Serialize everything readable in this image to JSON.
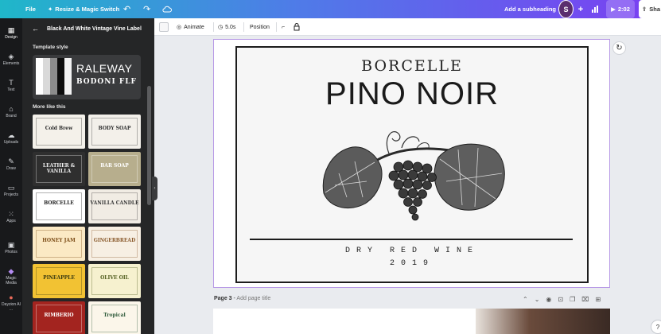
{
  "topbar": {
    "file": "File",
    "resize": "Resize & Magic Switch",
    "add_subheading": "Add a subheading",
    "avatar_initial": "S",
    "timer": "2:02",
    "share": "Sha"
  },
  "rail": {
    "items": [
      {
        "label": "Design",
        "icon": "design-icon"
      },
      {
        "label": "Elements",
        "icon": "elements-icon"
      },
      {
        "label": "Text",
        "icon": "text-icon"
      },
      {
        "label": "Brand",
        "icon": "brand-icon"
      },
      {
        "label": "Uploads",
        "icon": "uploads-icon"
      },
      {
        "label": "Draw",
        "icon": "draw-icon"
      },
      {
        "label": "Projects",
        "icon": "projects-icon"
      },
      {
        "label": "Apps",
        "icon": "apps-icon"
      },
      {
        "label": "Photos",
        "icon": "photos-icon"
      },
      {
        "label": "Magic Media",
        "icon": "magic-media-icon"
      },
      {
        "label": "Dayzion AI ...",
        "icon": "ai-app-icon"
      }
    ]
  },
  "panel": {
    "title": "Black And White Vintage Vine Label",
    "template_style": "Template style",
    "font_primary": "RALEWAY",
    "font_secondary": "BODONI FLF",
    "more_like_this": "More like this",
    "thumbnails": [
      {
        "title": "Cold Brew",
        "subtitle": "",
        "bg": "#f4f1ea",
        "fg": "#2b2b2b"
      },
      {
        "title": "BODY SOAP",
        "subtitle": "",
        "bg": "#f3f0ea",
        "fg": "#333333"
      },
      {
        "title": "LEATHER & VANILLA",
        "subtitle": "",
        "bg": "#2f2f2f",
        "fg": "#f2f2f2"
      },
      {
        "title": "BAR SOAP",
        "subtitle": "",
        "bg": "#b7ae8d",
        "fg": "#ffffff"
      },
      {
        "title": "BORCELLE",
        "subtitle": "",
        "bg": "#ffffff",
        "fg": "#1f1f1f"
      },
      {
        "title": "VANILLA CANDLE",
        "subtitle": "",
        "bg": "#f1ece4",
        "fg": "#3a3a3a"
      },
      {
        "title": "HONEY JAM",
        "subtitle": "",
        "bg": "#fbe9c4",
        "fg": "#7a4a14"
      },
      {
        "title": "GINGERBREAD",
        "subtitle": "",
        "bg": "#f7efe3",
        "fg": "#8a5a2c"
      },
      {
        "title": "PINEAPPLE",
        "subtitle": "",
        "bg": "#f2c233",
        "fg": "#3b3b10"
      },
      {
        "title": "OLIVE OIL",
        "subtitle": "",
        "bg": "#f6f1cf",
        "fg": "#4d5a1a"
      },
      {
        "title": "RIMBERIO",
        "subtitle": "",
        "bg": "#a3241f",
        "fg": "#ffffff"
      },
      {
        "title": "Tropical",
        "subtitle": "",
        "bg": "#fbf6ea",
        "fg": "#2e5a3a"
      }
    ]
  },
  "context_toolbar": {
    "animate": "Animate",
    "duration": "5.0s",
    "position": "Position"
  },
  "label": {
    "brand": "BORCELLE",
    "product": "PINO NOIR",
    "wine_type": "DRY RED WINE",
    "year": "2019"
  },
  "page3": {
    "page_label": "Page 3",
    "separator": " - ",
    "title_placeholder": "Add page title"
  },
  "colors": {
    "accent": "#7b3ff2",
    "page_border": "#b89ae6",
    "panel_bg": "#252627"
  }
}
